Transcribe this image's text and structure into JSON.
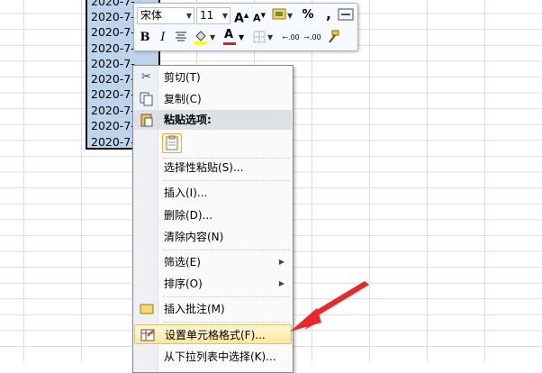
{
  "cells": [
    "2020-7-",
    "2020-7-",
    "2020-7-",
    "2020-7-",
    "2020-7-",
    "2020-7-",
    "2020-7-",
    "2020-7-",
    "2020-7-",
    "2020-7-"
  ],
  "mini_toolbar": {
    "font_name": "宋体",
    "font_size": "11",
    "grow_font": "A",
    "shrink_font": "A",
    "percent": "%",
    "comma": ",",
    "bold": "B",
    "italic": "I",
    "font_color": "A",
    "dec_increase": ".00",
    "dec_decrease": ".00"
  },
  "context_menu": {
    "cut": "剪切(T)",
    "copy": "复制(C)",
    "paste_options": "粘贴选项:",
    "paste_special": "选择性粘贴(S)...",
    "insert": "插入(I)...",
    "delete": "删除(D)...",
    "clear_contents": "清除内容(N)",
    "filter": "筛选(E)",
    "sort": "排序(O)",
    "insert_comment": "插入批注(M)",
    "format_cells": "设置单元格格式(F)...",
    "pick_from_list": "从下拉列表中选择(K)..."
  },
  "colors": {
    "selection": "#bcd4ec",
    "highlight": "#ffe79b",
    "arrow": "#e8282d"
  }
}
